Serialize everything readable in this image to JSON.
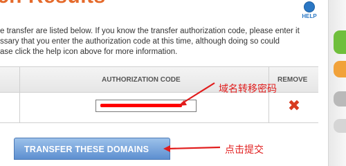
{
  "page": {
    "title": "ch Results",
    "help_label": "HELP",
    "description_lines": [
      "e transfer are listed below. If you know the transfer authorization code, please enter it",
      "ssary that you enter the authorization code at this time, although doing so could",
      "ase click the help icon above for more information."
    ]
  },
  "table": {
    "headers": {
      "authorization_code": "AUTHORIZATION CODE",
      "remove": "REMOVE"
    },
    "row": {
      "remove_icon": "close-icon",
      "remove_glyph": "✖"
    }
  },
  "actions": {
    "transfer_button": "TRANSFER THESE DOMAINS"
  },
  "annotations": {
    "auth_note": "域名转移密码",
    "button_note": "点击提交"
  },
  "colors": {
    "title": "#e56a2b",
    "help": "#2a77c4",
    "annotation": "#e11c1c",
    "button_top": "#9cc1ea",
    "button_bottom": "#5d8fd0",
    "remove_icon": "#d83a1f"
  }
}
